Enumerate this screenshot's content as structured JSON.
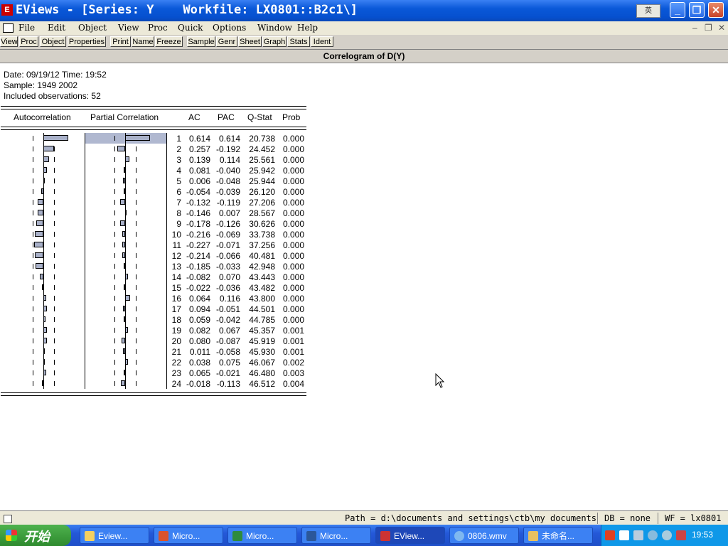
{
  "window": {
    "app_icon": "eviews-icon",
    "title": "EViews - [Series: Y    Workfile: LX0801::B2c1\\]",
    "ime_indicator": "英"
  },
  "menu": [
    "File",
    "Edit",
    "Object",
    "View",
    "Proc",
    "Quick",
    "Options",
    "Window",
    "Help"
  ],
  "toolbar": [
    "View",
    "Proc",
    "Object",
    "Properties",
    "Print",
    "Name",
    "Freeze",
    "Sample",
    "Genr",
    "Sheet",
    "Graph",
    "Stats",
    "Ident"
  ],
  "view_title": "Correlogram of D(Y)",
  "header": {
    "date_line": "Date: 09/19/12   Time: 19:52",
    "sample_line": "Sample: 1949 2002",
    "obs_line": "Included observations: 52"
  },
  "columns": {
    "autocorrelation": "Autocorrelation",
    "partial": "Partial Correlation",
    "ac": "AC",
    "pac": "PAC",
    "qstat": "Q-Stat",
    "prob": "Prob"
  },
  "correlogram": [
    {
      "lag": "1",
      "ac": "0.614",
      "pac": "0.614",
      "q": "20.738",
      "prob": "0.000"
    },
    {
      "lag": "2",
      "ac": "0.257",
      "pac": "-0.192",
      "q": "24.452",
      "prob": "0.000"
    },
    {
      "lag": "3",
      "ac": "0.139",
      "pac": "0.114",
      "q": "25.561",
      "prob": "0.000"
    },
    {
      "lag": "4",
      "ac": "0.081",
      "pac": "-0.040",
      "q": "25.942",
      "prob": "0.000"
    },
    {
      "lag": "5",
      "ac": "0.006",
      "pac": "-0.048",
      "q": "25.944",
      "prob": "0.000"
    },
    {
      "lag": "6",
      "ac": "-0.054",
      "pac": "-0.039",
      "q": "26.120",
      "prob": "0.000"
    },
    {
      "lag": "7",
      "ac": "-0.132",
      "pac": "-0.119",
      "q": "27.206",
      "prob": "0.000"
    },
    {
      "lag": "8",
      "ac": "-0.146",
      "pac": "0.007",
      "q": "28.567",
      "prob": "0.000"
    },
    {
      "lag": "9",
      "ac": "-0.178",
      "pac": "-0.126",
      "q": "30.626",
      "prob": "0.000"
    },
    {
      "lag": "10",
      "ac": "-0.216",
      "pac": "-0.069",
      "q": "33.738",
      "prob": "0.000"
    },
    {
      "lag": "11",
      "ac": "-0.227",
      "pac": "-0.071",
      "q": "37.256",
      "prob": "0.000"
    },
    {
      "lag": "12",
      "ac": "-0.214",
      "pac": "-0.066",
      "q": "40.481",
      "prob": "0.000"
    },
    {
      "lag": "13",
      "ac": "-0.185",
      "pac": "-0.033",
      "q": "42.948",
      "prob": "0.000"
    },
    {
      "lag": "14",
      "ac": "-0.082",
      "pac": "0.070",
      "q": "43.443",
      "prob": "0.000"
    },
    {
      "lag": "15",
      "ac": "-0.022",
      "pac": "-0.036",
      "q": "43.482",
      "prob": "0.000"
    },
    {
      "lag": "16",
      "ac": "0.064",
      "pac": "0.116",
      "q": "43.800",
      "prob": "0.000"
    },
    {
      "lag": "17",
      "ac": "0.094",
      "pac": "-0.051",
      "q": "44.501",
      "prob": "0.000"
    },
    {
      "lag": "18",
      "ac": "0.059",
      "pac": "-0.042",
      "q": "44.785",
      "prob": "0.000"
    },
    {
      "lag": "19",
      "ac": "0.082",
      "pac": "0.067",
      "q": "45.357",
      "prob": "0.001"
    },
    {
      "lag": "20",
      "ac": "0.080",
      "pac": "-0.087",
      "q": "45.919",
      "prob": "0.001"
    },
    {
      "lag": "21",
      "ac": "0.011",
      "pac": "-0.058",
      "q": "45.930",
      "prob": "0.001"
    },
    {
      "lag": "22",
      "ac": "0.038",
      "pac": "0.075",
      "q": "46.067",
      "prob": "0.002"
    },
    {
      "lag": "23",
      "ac": "0.065",
      "pac": "-0.021",
      "q": "46.480",
      "prob": "0.003"
    },
    {
      "lag": "24",
      "ac": "-0.018",
      "pac": "-0.113",
      "q": "46.512",
      "prob": "0.004"
    }
  ],
  "status": {
    "path": "Path = d:\\documents and settings\\ctb\\my documents",
    "db": "DB = none",
    "wf": "WF = lx0801"
  },
  "taskbar": {
    "start_label": "开始",
    "tasks": [
      "Eview...",
      "Micro...",
      "Micro...",
      "Micro...",
      "EView...",
      "0806.wmv",
      "未命名..."
    ],
    "active_task": "EView...",
    "clock": "19:53"
  },
  "colors": {
    "bar_fill": "#a8b0c8",
    "highlight": "#b0b8d0",
    "titlebar": "#0a58d8",
    "taskbar": "#2458d8"
  }
}
